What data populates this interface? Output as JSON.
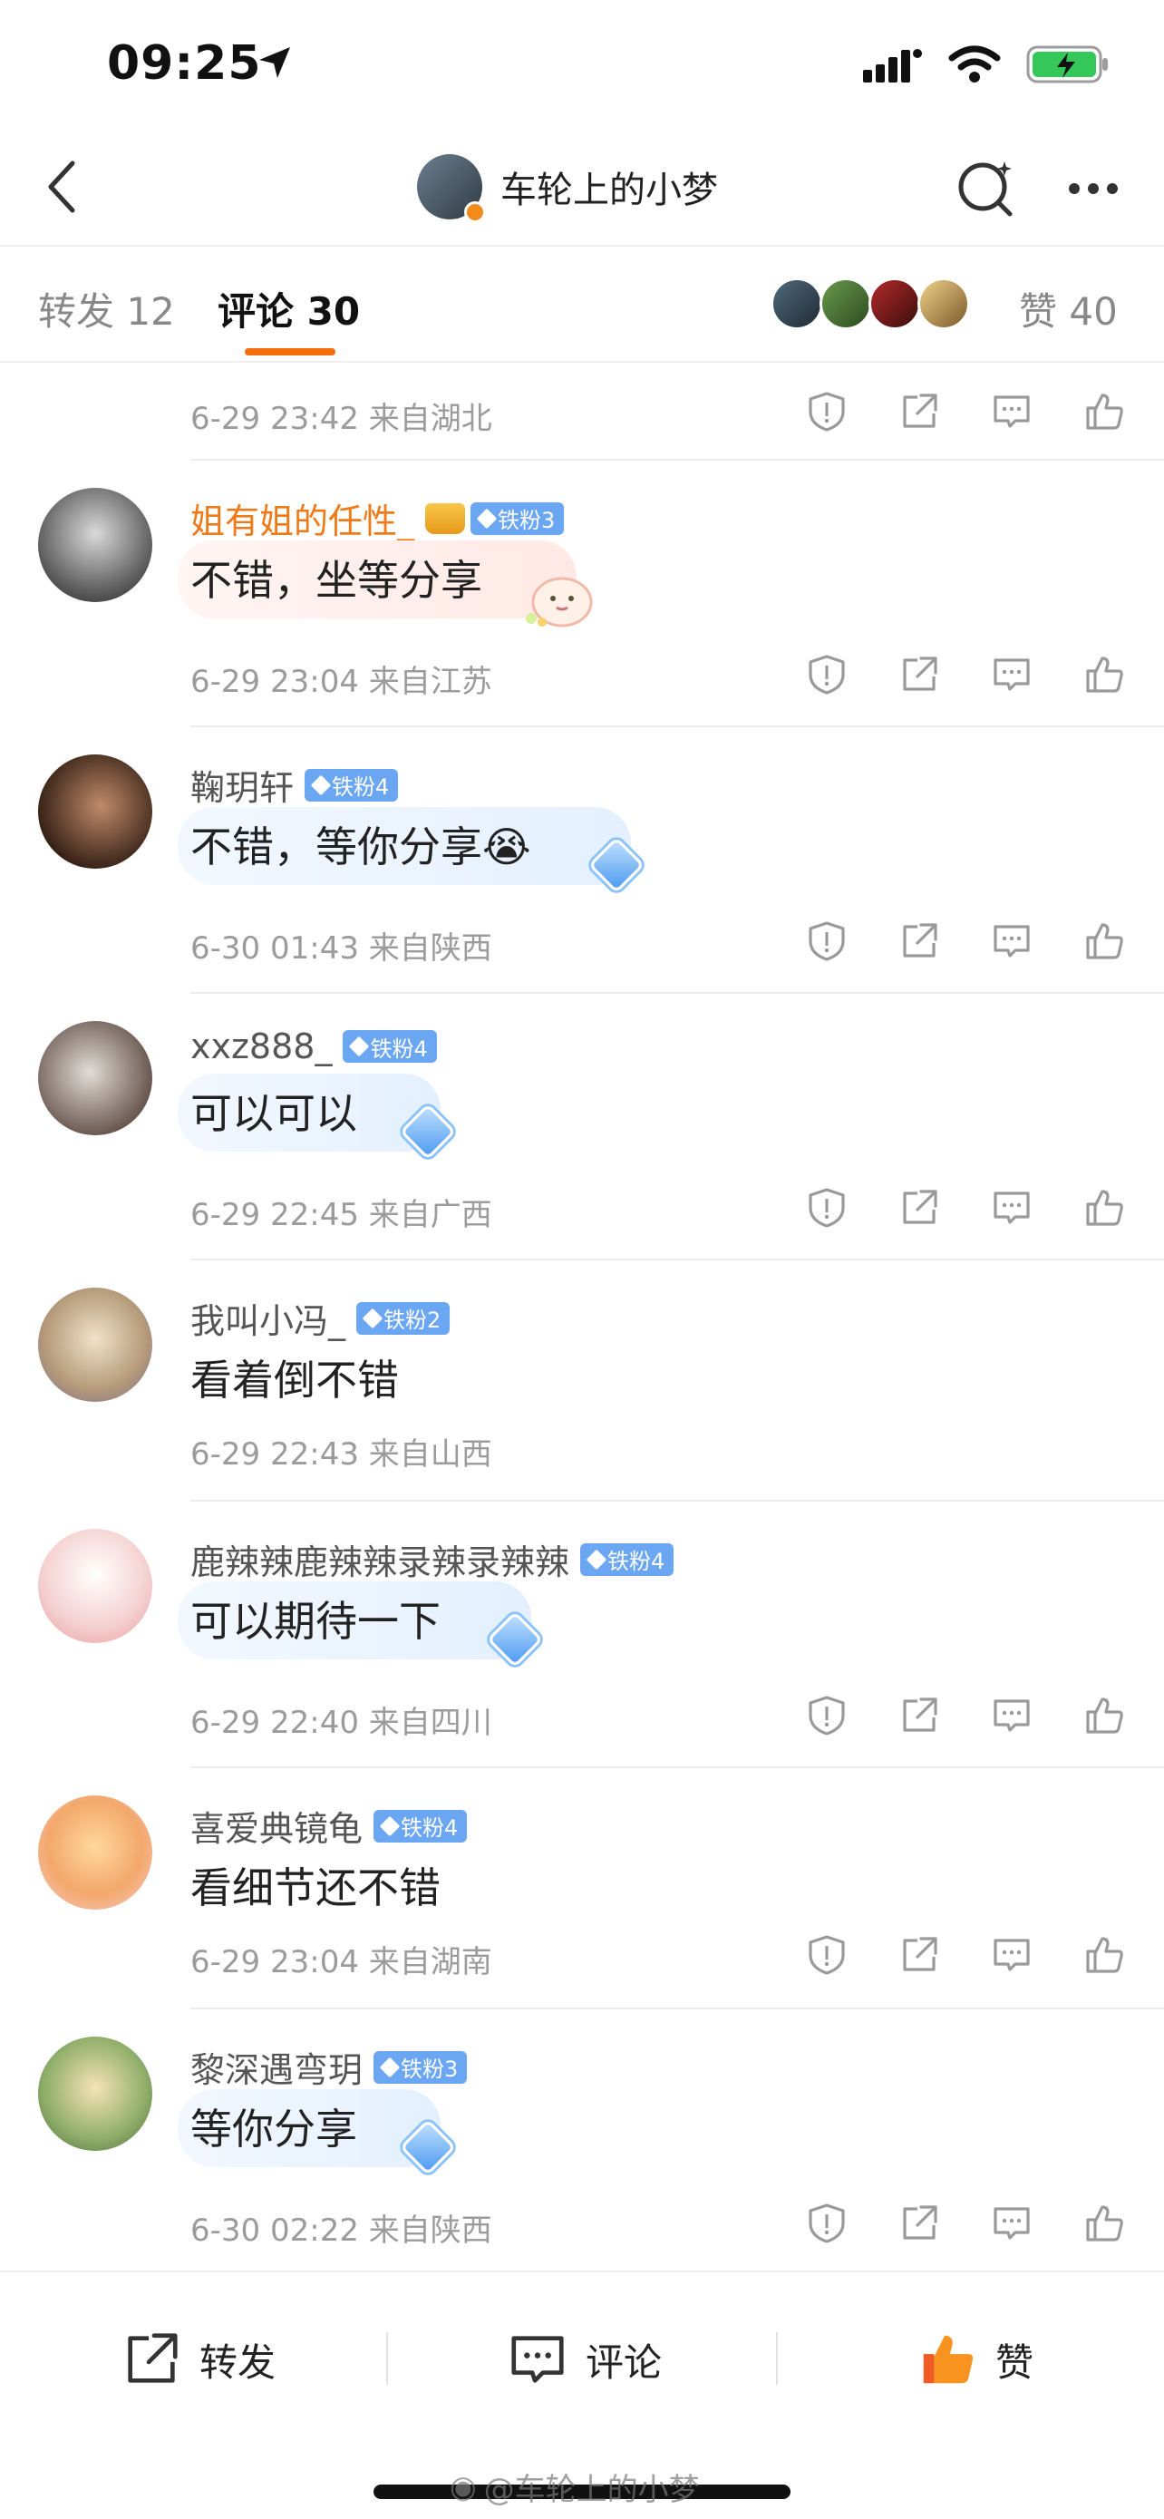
{
  "status_bar": {
    "time": "09:25"
  },
  "nav": {
    "title": "车轮上的小梦"
  },
  "tabs": {
    "repost_label": "转发 12",
    "comment_label": "评论 30",
    "likes_label": "赞 40"
  },
  "first_meta": {
    "time": "6-29 23:42",
    "location": "来自湖北"
  },
  "comments": [
    {
      "name": "姐有姐的任性_",
      "badge": "铁粉3",
      "text": "不错，坐等分享",
      "time": "6-29 23:04",
      "location": "来自江苏"
    },
    {
      "name": "鞠玥轩",
      "badge": "铁粉4",
      "text": "不错，等你分享😭",
      "time": "6-30 01:43",
      "location": "来自陕西"
    },
    {
      "name": "xxz888_",
      "badge": "铁粉4",
      "text": "可以可以",
      "time": "6-29 22:45",
      "location": "来自广西"
    },
    {
      "name": "我叫小冯_",
      "badge": "铁粉2",
      "text": "看着倒不错",
      "time": "6-29 22:43",
      "location": "来自山西"
    },
    {
      "name": "鹿辣辣鹿辣辣录辣录辣辣",
      "badge": "铁粉4",
      "text": "可以期待一下",
      "time": "6-29 22:40",
      "location": "来自四川"
    },
    {
      "name": "喜爱典镜龟",
      "badge": "铁粉4",
      "text": "看细节还不错",
      "time": "6-29 23:04",
      "location": "来自湖南"
    },
    {
      "name": "黎深遇弯玥",
      "badge": "铁粉3",
      "text": "等你分享",
      "time": "6-30 02:22",
      "location": "来自陕西"
    }
  ],
  "bottom_bar": {
    "repost": "转发",
    "comment": "评论",
    "like": "赞"
  },
  "watermark": "@车轮上的小梦",
  "colors": {
    "accent": "#f56e0a",
    "fan_badge": "#6aa6f2",
    "name_highlight": "#f07a18"
  },
  "icons": [
    "back-icon",
    "search-icon",
    "more-icon",
    "report-icon",
    "share-icon",
    "comment-icon",
    "like-icon"
  ]
}
